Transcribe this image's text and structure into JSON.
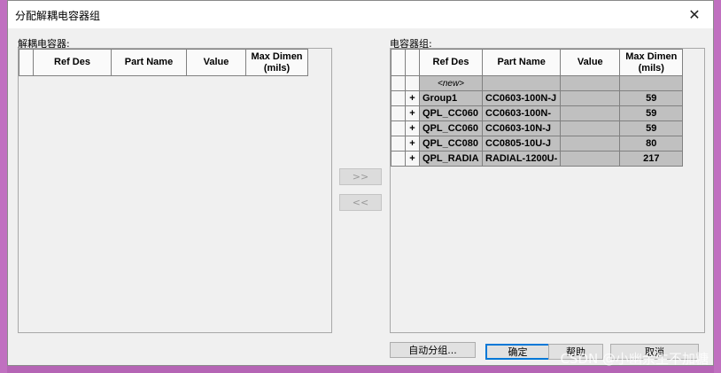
{
  "window": {
    "title": "分配解耦电容器组",
    "close_glyph": "✕"
  },
  "left_panel": {
    "label": "解耦电容器:",
    "columns": [
      "Ref Des",
      "Part Name",
      "Value",
      "Max Dimen\n(mils)"
    ]
  },
  "right_panel": {
    "label": "电容器组:",
    "columns": [
      "Ref Des",
      "Part Name",
      "Value",
      "Max Dimen\n(mils)"
    ],
    "rows": [
      {
        "expand": "",
        "ref_des": "<new>",
        "part_name": "",
        "value": "",
        "max_dimen": ""
      },
      {
        "expand": "+",
        "ref_des": "Group1",
        "part_name": "CC0603-100N-J",
        "value": "",
        "max_dimen": "59"
      },
      {
        "expand": "+",
        "ref_des": "QPL_CC060",
        "part_name": "CC0603-100N-",
        "value": "",
        "max_dimen": "59"
      },
      {
        "expand": "+",
        "ref_des": "QPL_CC060",
        "part_name": "CC0603-10N-J",
        "value": "",
        "max_dimen": "59"
      },
      {
        "expand": "+",
        "ref_des": "QPL_CC080",
        "part_name": "CC0805-10U-J",
        "value": "",
        "max_dimen": "80"
      },
      {
        "expand": "+",
        "ref_des": "QPL_RADIA",
        "part_name": "RADIAL-1200U-",
        "value": "",
        "max_dimen": "217"
      }
    ]
  },
  "transfer": {
    "add_label": ">>",
    "remove_label": "<<"
  },
  "buttons": {
    "auto_group": "自动分组...",
    "ok": "确定",
    "help": "帮助",
    "cancel": "取消"
  },
  "watermark": "CSDN @小幽余生不加糖"
}
